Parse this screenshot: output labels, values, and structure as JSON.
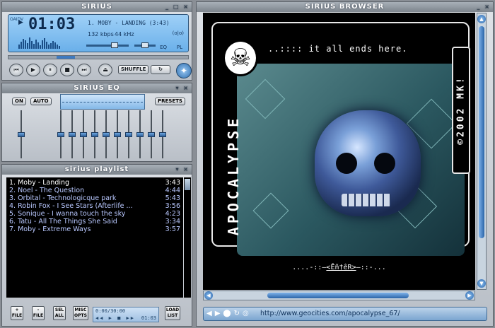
{
  "player": {
    "title": "SIRIUS",
    "window_controls": "_ □ ×",
    "vertical_label": "OAIDV",
    "play_indicator": "▶",
    "time": "01:03",
    "track": "1. MOBY - LANDING (3:43)",
    "kbps": "132 kbps",
    "khz": "44 kHz",
    "mode": "(o|o)",
    "eq_label": "EQ",
    "pl_label": "PL",
    "volume_level": 0.7,
    "balance_level": 0.5,
    "seek_position": 0.28,
    "buttons": {
      "prev": "⏮",
      "play": "▶",
      "pause": "⏸",
      "stop": "■",
      "next": "⏭",
      "eject": "⏏",
      "shuffle": "SHUFFLE",
      "repeat": "↻"
    }
  },
  "eq": {
    "title": "SIRIUS EQ",
    "on_label": "ON",
    "auto_label": "AUTO",
    "presets_label": "PRESETS",
    "preamp_level": 0.5,
    "bands": [
      0.5,
      0.5,
      0.5,
      0.5,
      0.5,
      0.5,
      0.5,
      0.5,
      0.5,
      0.5
    ]
  },
  "playlist": {
    "title": "sirius playlist",
    "items": [
      {
        "title": "1. Moby - Landing",
        "time": "3:43"
      },
      {
        "title": "2. Noel - The Question",
        "time": "4:44"
      },
      {
        "title": "3. Orbital - Technologicque park",
        "time": "5:43"
      },
      {
        "title": "4. Robin Fox - I See Stars (Afterlife ...",
        "time": "3:56"
      },
      {
        "title": "5. Sonique - I wanna touch the sky",
        "time": "4:23"
      },
      {
        "title": "6. Tatu - All The Things She Said",
        "time": "3:34"
      },
      {
        "title": "7. Moby - Extreme Ways",
        "time": "3:57"
      }
    ],
    "buttons": {
      "add": "+\nFILE",
      "remove": "-\nFILE",
      "select": "SEL\nALL",
      "misc": "MISC\nOPTS",
      "load": "LOAD\nLIST"
    },
    "mini_time": "0:00/30:00",
    "mini_controls": "◀◀ ▶ ■ ▶▶",
    "mini_counter": "01:03"
  },
  "browser": {
    "title": "SIRIUS BROWSER",
    "tagline": "..:::: it all ends here.",
    "vertical_left": "APOCALYPSE",
    "vertical_right": "©2002 MK!",
    "enter_prefix": "....-::—",
    "enter_link": "<Êñ†êR>",
    "enter_suffix": "—::-...",
    "address_nav": "◀▶⬤↻◎",
    "url": "http://www.geocities.com/apocalypse_67/"
  }
}
